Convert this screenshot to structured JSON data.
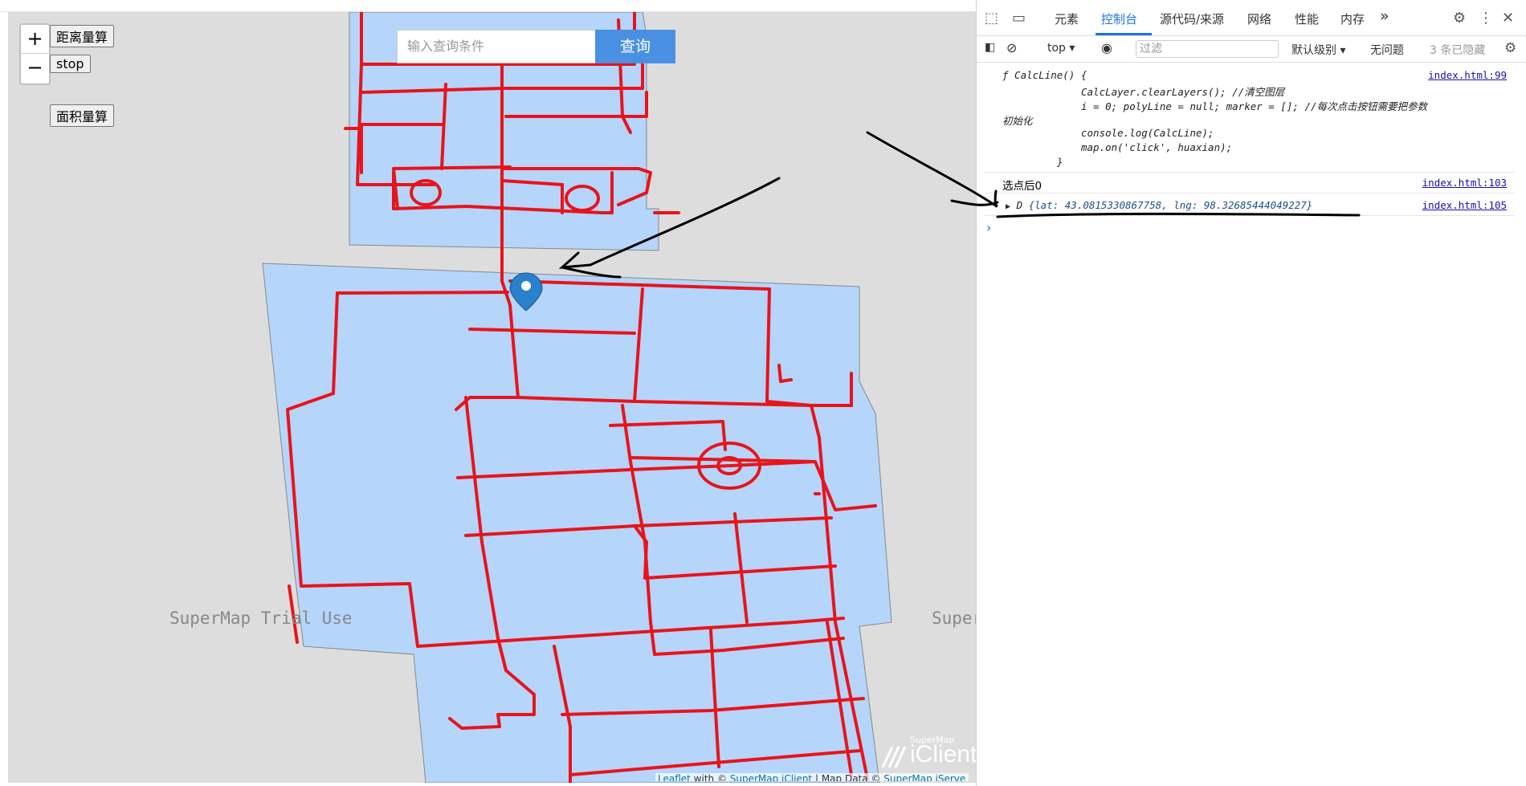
{
  "map": {
    "zoom_in": "+",
    "zoom_out": "−",
    "btn_distance": "距离量算",
    "btn_stop": "stop",
    "btn_area": "面积量算",
    "search_placeholder": "输入查询条件",
    "search_button": "查询",
    "watermark1": "SuperMap Trial Use",
    "watermark2": "Super",
    "iclient_small": "SuperMap",
    "iclient_big": "iClient",
    "attribution": {
      "leaflet": "Leaflet",
      "with": " with © ",
      "supermap": "SuperMap iClient",
      "mapdata": " | Map Data © ",
      "iserver": "SuperMap iServe"
    }
  },
  "devtools": {
    "tabs": [
      "元素",
      "控制台",
      "源代码/来源",
      "网络",
      "性能",
      "内存"
    ],
    "more_tabs": "»",
    "context": "top",
    "filter_placeholder": "过滤",
    "level": "默认级别",
    "issues": "无问题",
    "hidden": "3 条已隐藏",
    "code_line1": "ƒ CalcLine() {",
    "code_line2": "CalcLayer.clearLayers();    //清空图层",
    "code_line3": "i = 0; polyLine = null; marker = [];    //每次点击按钮需要把参数",
    "code_line4": "初始化",
    "code_line5": "console.log(CalcLine);",
    "code_line6": "map.on('click', huaxian);",
    "code_line7": "}",
    "link1": "index.html:99",
    "log2": "选点后0",
    "link2": "index.html:103",
    "obj_prefix": "D ",
    "obj_text": "{lat: 43.0815330867758, lng: 98.32685444049227}",
    "link3": "index.html:105",
    "prompt": "›"
  }
}
